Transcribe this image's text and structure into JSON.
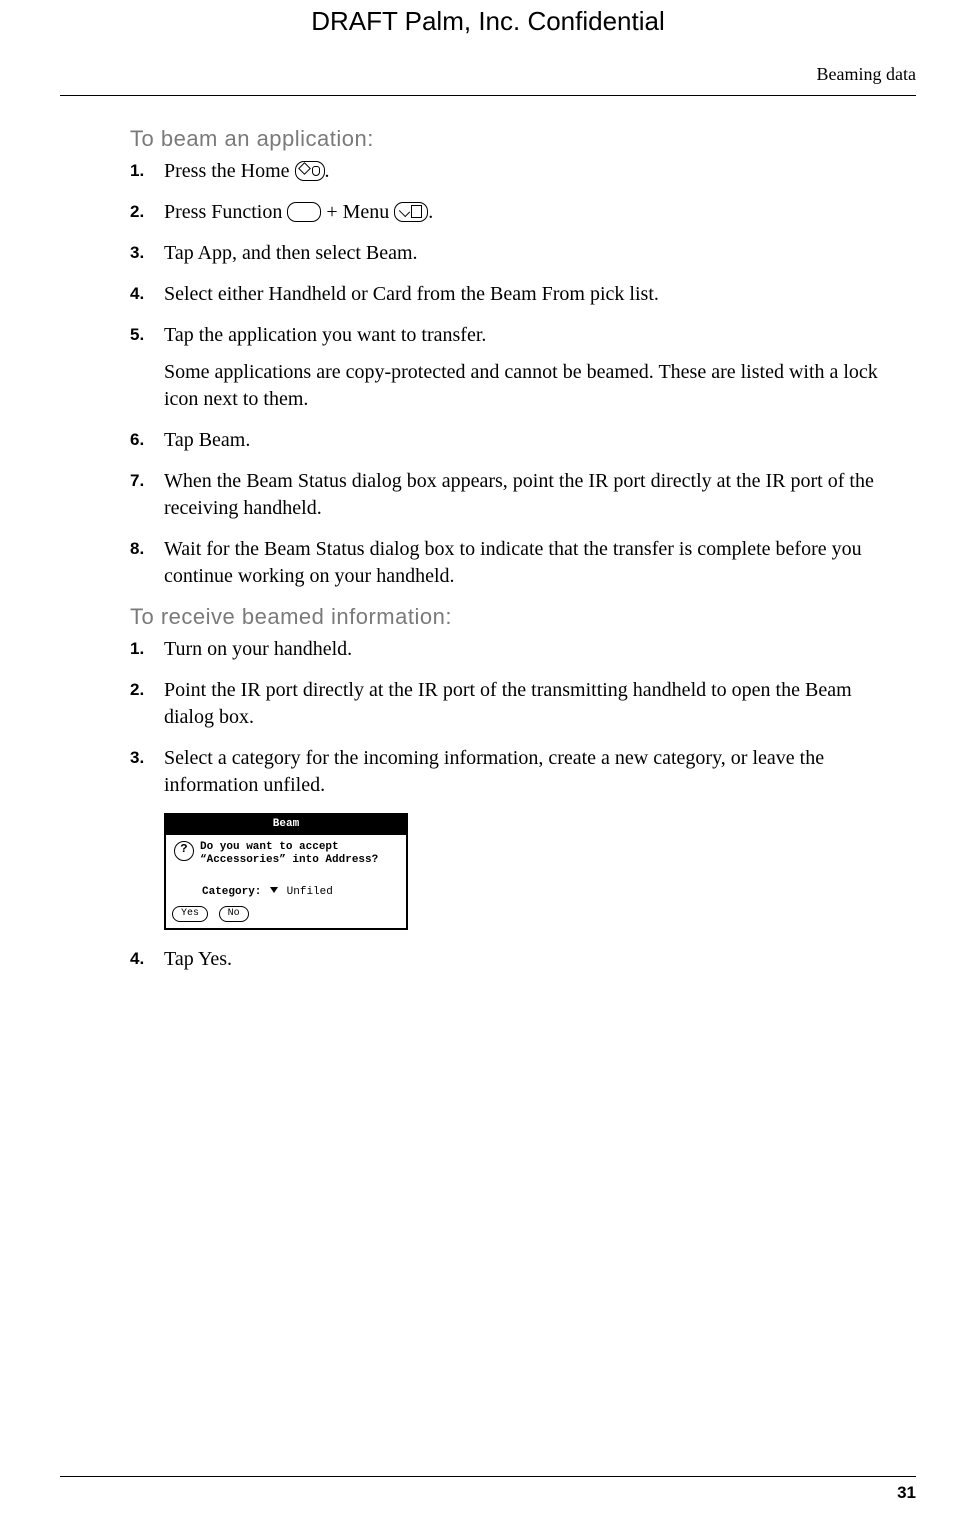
{
  "draft_header": "DRAFT   Palm, Inc. Confidential",
  "running_head": "Beaming data",
  "page_number": "31",
  "section1": {
    "title": "To beam an application:",
    "steps": [
      {
        "n": "1.",
        "parts": [
          "Press the Home ",
          "ICON:home",
          "."
        ]
      },
      {
        "n": "2.",
        "parts": [
          "Press Function ",
          "ICON:btn",
          " + Menu ",
          "ICON:menu",
          "."
        ]
      },
      {
        "n": "3.",
        "text": "Tap App, and then select Beam."
      },
      {
        "n": "4.",
        "text": "Select either Handheld or Card from the Beam From pick list."
      },
      {
        "n": "5.",
        "text": "Tap the application you want to transfer.",
        "note": "Some applications are copy-protected and cannot be beamed. These are listed with a lock icon next to them."
      },
      {
        "n": "6.",
        "text": "Tap Beam."
      },
      {
        "n": "7.",
        "text": "When the Beam Status dialog box appears, point the IR port directly at the IR port of the receiving handheld."
      },
      {
        "n": "8.",
        "text": "Wait for the Beam Status dialog box to indicate that the transfer is complete before you continue working on your handheld."
      }
    ]
  },
  "section2": {
    "title": "To receive beamed information:",
    "steps_before": [
      {
        "n": "1.",
        "text": "Turn on your handheld."
      },
      {
        "n": "2.",
        "text": "Point the IR port directly at the IR port of the transmitting handheld to open the Beam dialog box."
      },
      {
        "n": "3.",
        "text": "Select a category for the incoming information, create a new category, or leave the information unfiled."
      }
    ],
    "steps_after": [
      {
        "n": "4.",
        "text": "Tap Yes."
      }
    ]
  },
  "dialog": {
    "title": "Beam",
    "question_icon": "?",
    "question": "Do you want to accept “Accessories” into Address?",
    "category_label": "Category:",
    "category_value": "Unfiled",
    "yes": "Yes",
    "no": "No"
  }
}
